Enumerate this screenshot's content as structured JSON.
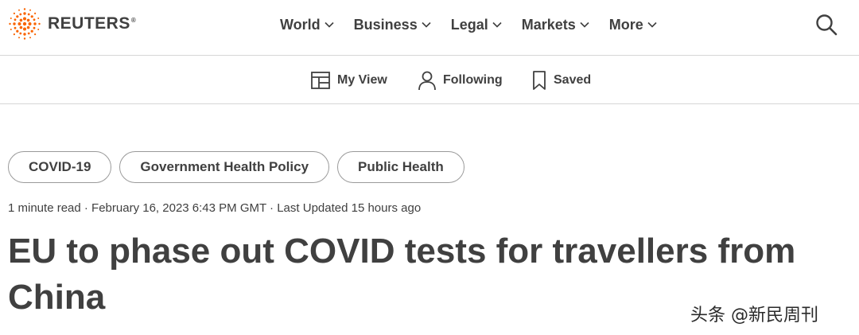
{
  "header": {
    "logo_text": "REUTERS",
    "logo_reg": "®",
    "nav": [
      {
        "label": "World"
      },
      {
        "label": "Business"
      },
      {
        "label": "Legal"
      },
      {
        "label": "Markets"
      },
      {
        "label": "More"
      }
    ]
  },
  "subnav": {
    "my_view": "My View",
    "following": "Following",
    "saved": "Saved"
  },
  "article": {
    "tags": [
      "COVID-19",
      "Government Health Policy",
      "Public Health"
    ],
    "meta": "1 minute read · February 16, 2023 6:43 PM GMT · Last Updated 15 hours ago",
    "headline_line1": "EU to phase out COVID tests for travellers from",
    "headline_line2": "China"
  },
  "watermark": "头条 @新民周刊",
  "colors": {
    "text": "#404040",
    "logo_orange": "#fa6400",
    "border": "#d6d6d6"
  }
}
